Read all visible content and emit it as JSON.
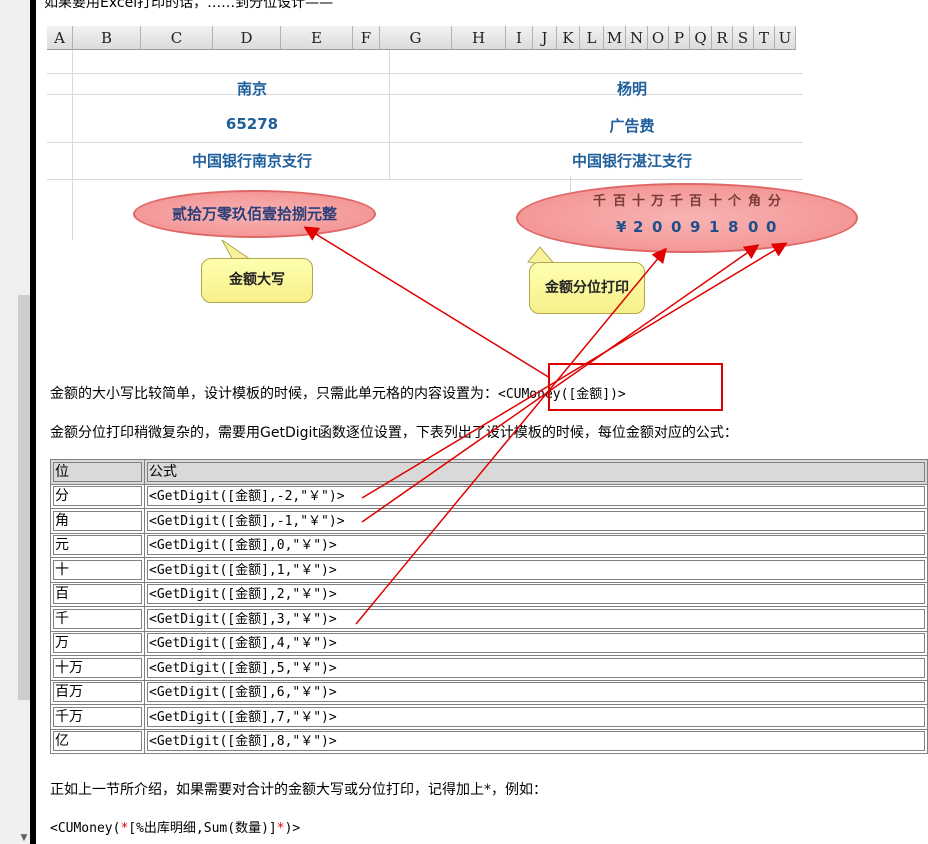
{
  "top_text": "如果要用Excel打印的话，……到分位设计——",
  "sheet": {
    "columns": [
      "A",
      "B",
      "C",
      "D",
      "E",
      "F",
      "G",
      "H",
      "I",
      "J",
      "K",
      "L",
      "M",
      "N",
      "O",
      "P",
      "Q",
      "R",
      "S",
      "T",
      "U"
    ],
    "cells": {
      "city": "南京",
      "person": "杨明",
      "amount": "65278",
      "purpose": "广告费",
      "bank_left": "中国银行南京支行",
      "bank_right": "中国银行湛江支行"
    },
    "upper_amount": "贰拾万零玖佰壹拾捌元整",
    "digit_headers": [
      "千",
      "百",
      "十",
      "万",
      "千",
      "百",
      "十",
      "个",
      "角",
      "分"
    ],
    "digit_values": [
      "¥",
      "2",
      "0",
      "0",
      "9",
      "1",
      "8",
      "0",
      "0"
    ],
    "callout_upper": "金额大写",
    "callout_digits": "金额分位打印"
  },
  "paragraphs": {
    "p1": "金额的大小写比较简单，设计模板的时候，只需此单元格的内容设置为：",
    "p1_code": "<CUMoney([金额])>",
    "p2": "金额分位打印稍微复杂的，需要用GetDigit函数逐位设置，下表列出了设计模板的时候，每位金额对应的公式：",
    "p3": "正如上一节所介绍，如果需要对合计的金额大写或分位打印，记得加上*，例如：",
    "code_prefix": "<CUMoney(",
    "code_star1": "*",
    "code_mid": "[%出库明细,Sum(数量)]",
    "code_star2": "*",
    "code_suffix": ")>"
  },
  "table": {
    "headers": [
      "位",
      "公式"
    ],
    "rows": [
      [
        "分",
        "<GetDigit([金额],-2,\"￥\")>"
      ],
      [
        "角",
        "<GetDigit([金额],-1,\"￥\")>"
      ],
      [
        "元",
        "<GetDigit([金额],0,\"￥\")>"
      ],
      [
        "十",
        "<GetDigit([金额],1,\"￥\")>"
      ],
      [
        "百",
        "<GetDigit([金额],2,\"￥\")>"
      ],
      [
        "千",
        "<GetDigit([金额],3,\"￥\")>"
      ],
      [
        "万",
        "<GetDigit([金额],4,\"￥\")>"
      ],
      [
        "十万",
        "<GetDigit([金额],5,\"￥\")>"
      ],
      [
        "百万",
        "<GetDigit([金额],6,\"￥\")>"
      ],
      [
        "千万",
        "<GetDigit([金额],7,\"￥\")>"
      ],
      [
        "亿",
        "<GetDigit([金额],8,\"￥\")>"
      ]
    ]
  },
  "colors": {
    "accent_blue": "#1f5f9c",
    "arrow_red": "#e00000",
    "header_gray": "#d9d9d9"
  }
}
